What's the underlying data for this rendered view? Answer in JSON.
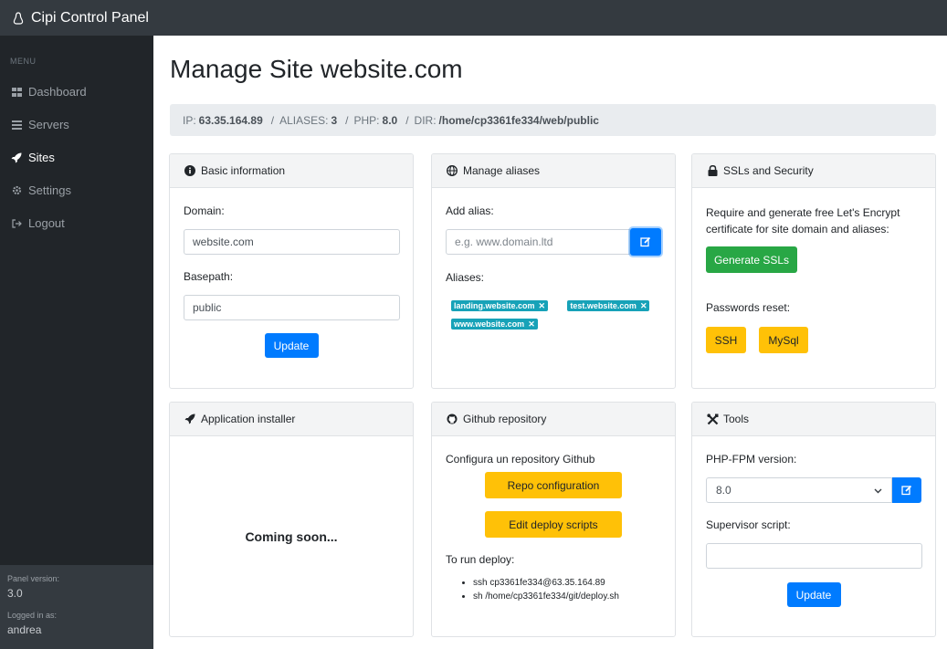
{
  "app": {
    "title": "Cipi Control Panel"
  },
  "sidebar": {
    "menu_heading": "MENU",
    "items": [
      {
        "label": "Dashboard",
        "icon": "dashboard-icon"
      },
      {
        "label": "Servers",
        "icon": "servers-icon"
      },
      {
        "label": "Sites",
        "icon": "rocket-icon",
        "active": true
      },
      {
        "label": "Settings",
        "icon": "gear-icon"
      },
      {
        "label": "Logout",
        "icon": "logout-icon"
      }
    ],
    "footer": {
      "version_label": "Panel version:",
      "version_value": "3.0",
      "logged_label": "Logged in as:",
      "logged_value": "andrea"
    }
  },
  "page": {
    "title": "Manage Site website.com",
    "info": {
      "ip_label": "IP:",
      "ip": "63.35.164.89",
      "aliases_label": "ALIASES:",
      "aliases": "3",
      "php_label": "PHP:",
      "php": "8.0",
      "dir_label": "DIR:",
      "dir": "/home/cp3361fe334/web/public",
      "separator": "/"
    }
  },
  "basic": {
    "header": "Basic information",
    "domain_label": "Domain:",
    "domain_value": "website.com",
    "basepath_label": "Basepath:",
    "basepath_value": "public",
    "update_label": "Update"
  },
  "aliases": {
    "header": "Manage aliases",
    "add_label": "Add alias:",
    "add_placeholder": "e.g. www.domain.ltd",
    "list_label": "Aliases:",
    "items": [
      "landing.website.com",
      "test.website.com",
      "www.website.com"
    ],
    "remove_glyph": "✕"
  },
  "ssl": {
    "header": "SSLs and Security",
    "description": "Require and generate free Let's Encrypt certificate for site domain and aliases:",
    "generate_label": "Generate SSLs",
    "passwords_label": "Passwords reset:",
    "ssh_label": "SSH",
    "mysql_label": "MySql"
  },
  "installer": {
    "header": "Application installer",
    "coming_soon": "Coming soon..."
  },
  "github": {
    "header": "Github repository",
    "intro": "Configura un repository Github",
    "repo_config_label": "Repo configuration",
    "deploy_scripts_label": "Edit deploy scripts",
    "run_deploy_label": "To run deploy:",
    "commands": [
      "ssh cp3361fe334@63.35.164.89",
      "sh /home/cp3361fe334/git/deploy.sh"
    ]
  },
  "tools": {
    "header": "Tools",
    "php_fpm_label": "PHP-FPM version:",
    "php_fpm_value": "8.0",
    "supervisor_label": "Supervisor script:",
    "supervisor_value": "",
    "update_label": "Update"
  },
  "colors": {
    "primary": "#007bff",
    "success": "#28a745",
    "warning": "#ffc107",
    "info": "#17a2b8",
    "sidebar": "#212529",
    "topbar": "#343a40"
  }
}
